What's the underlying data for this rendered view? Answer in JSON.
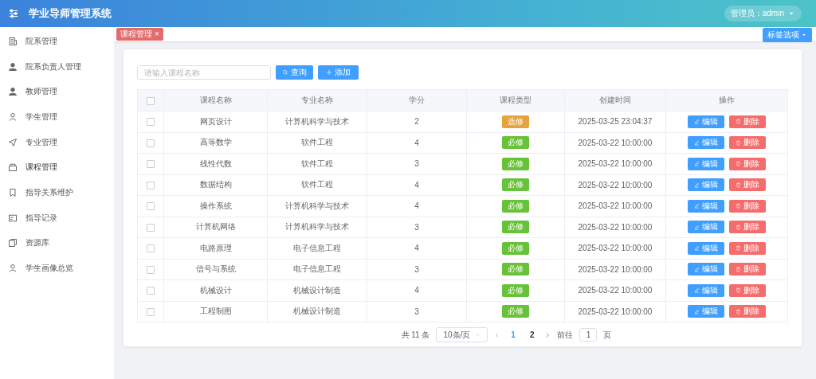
{
  "header": {
    "title": "学业导师管理系统",
    "user": "管理员：admin"
  },
  "sidebar": {
    "items": [
      {
        "label": "院系管理",
        "selected": false
      },
      {
        "label": "院系负责人管理",
        "selected": false
      },
      {
        "label": "教师管理",
        "selected": false
      },
      {
        "label": "学生管理",
        "selected": false
      },
      {
        "label": "专业管理",
        "selected": false
      },
      {
        "label": "课程管理",
        "selected": true
      },
      {
        "label": "指导关系维护",
        "selected": false
      },
      {
        "label": "指导记录",
        "selected": false
      },
      {
        "label": "资源库",
        "selected": false
      },
      {
        "label": "学生画像总览",
        "selected": false
      }
    ]
  },
  "tags": [
    {
      "label": "课程管理",
      "close": "×",
      "selected": true
    }
  ],
  "tag_options": "标签选项",
  "toolbar": {
    "search": {
      "placeholder": "请输入课程名称"
    },
    "query_button": "查询",
    "add_button": "添加"
  },
  "table": {
    "select_all": {
      "checked": false
    },
    "columns": [
      "课程名称",
      "专业名称",
      "学分",
      "课程类型",
      "创建时间",
      "操作"
    ],
    "rows": [
      {
        "checked": false,
        "name": "网页设计",
        "major": "计算机科学与技术",
        "credit": "2",
        "type": {
          "label": "选修",
          "kind": "elective"
        },
        "created": "2025-03-25 23:04:37",
        "edit": "编辑",
        "delete": "删除"
      },
      {
        "checked": false,
        "name": "高等数学",
        "major": "软件工程",
        "credit": "4",
        "type": {
          "label": "必修",
          "kind": "required"
        },
        "created": "2025-03-22 10:00:00",
        "edit": "编辑",
        "delete": "删除"
      },
      {
        "checked": false,
        "name": "线性代数",
        "major": "软件工程",
        "credit": "3",
        "type": {
          "label": "必修",
          "kind": "required"
        },
        "created": "2025-03-22 10:00:00",
        "edit": "编辑",
        "delete": "删除"
      },
      {
        "checked": false,
        "name": "数据结构",
        "major": "软件工程",
        "credit": "4",
        "type": {
          "label": "必修",
          "kind": "required"
        },
        "created": "2025-03-22 10:00:00",
        "edit": "编辑",
        "delete": "删除"
      },
      {
        "checked": false,
        "name": "操作系统",
        "major": "计算机科学与技术",
        "credit": "4",
        "type": {
          "label": "必修",
          "kind": "required"
        },
        "created": "2025-03-22 10:00:00",
        "edit": "编辑",
        "delete": "删除"
      },
      {
        "checked": false,
        "name": "计算机网络",
        "major": "计算机科学与技术",
        "credit": "3",
        "type": {
          "label": "必修",
          "kind": "required"
        },
        "created": "2025-03-22 10:00:00",
        "edit": "编辑",
        "delete": "删除"
      },
      {
        "checked": false,
        "name": "电路原理",
        "major": "电子信息工程",
        "credit": "4",
        "type": {
          "label": "必修",
          "kind": "required"
        },
        "created": "2025-03-22 10:00:00",
        "edit": "编辑",
        "delete": "删除"
      },
      {
        "checked": false,
        "name": "信号与系统",
        "major": "电子信息工程",
        "credit": "3",
        "type": {
          "label": "必修",
          "kind": "required"
        },
        "created": "2025-03-22 10:00:00",
        "edit": "编辑",
        "delete": "删除"
      },
      {
        "checked": false,
        "name": "机械设计",
        "major": "机械设计制造",
        "credit": "4",
        "type": {
          "label": "必修",
          "kind": "required"
        },
        "created": "2025-03-22 10:00:00",
        "edit": "编辑",
        "delete": "删除"
      },
      {
        "checked": false,
        "name": "工程制图",
        "major": "机械设计制造",
        "credit": "3",
        "type": {
          "label": "必修",
          "kind": "required"
        },
        "created": "2025-03-22 10:00:00",
        "edit": "编辑",
        "delete": "删除"
      }
    ]
  },
  "pagination": {
    "total": "共 11 条",
    "page_size": "10条/页",
    "pages": [
      {
        "label": "1",
        "selected": true
      },
      {
        "label": "2",
        "selected": false
      }
    ],
    "goto_label": "前往",
    "goto_value": "1",
    "goto_suffix": "页"
  }
}
